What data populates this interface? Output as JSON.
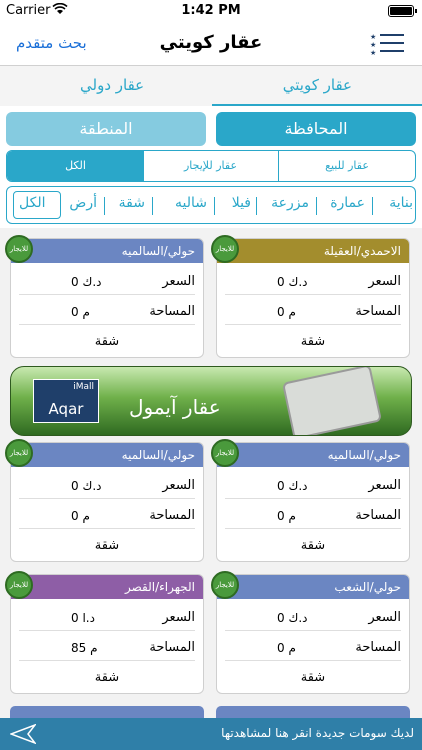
{
  "status": {
    "carrier": "Carrier",
    "time": "1:42 PM"
  },
  "nav": {
    "title": "عقار كويتي",
    "advanced": "بحث متقدم"
  },
  "tabs": {
    "kuwait": "عقار كويتي",
    "international": "عقار دولي"
  },
  "filters": {
    "governorate": "المحافظة",
    "region": "المنطقة"
  },
  "segments": {
    "sell": "عقار للبيع",
    "rent": "عقار للإيجار",
    "all": "الكل"
  },
  "types": [
    "بناية",
    "عمارة",
    "مزرعة",
    "فيلا",
    "شاليه",
    "شقة",
    "أرض",
    "الكل"
  ],
  "labels": {
    "price": "السعر",
    "area": "المساحة",
    "badge": "للايجار"
  },
  "cards": [
    {
      "location": "الاحمدي/العقيلة",
      "price": "0 د.ك",
      "area": "0 م",
      "type": "شقة",
      "color": "#a38d2d"
    },
    {
      "location": "حولي/السالميه",
      "price": "0 د.ك",
      "area": "0 م",
      "type": "شقة",
      "color": "#6b86c2"
    },
    {
      "location": "حولي/السالميه",
      "price": "0 د.ك",
      "area": "0 م",
      "type": "شقة",
      "color": "#6b86c2"
    },
    {
      "location": "حولي/السالميه",
      "price": "0 د.ك",
      "area": "0 م",
      "type": "شقة",
      "color": "#6b86c2"
    },
    {
      "location": "حولي/الشعب",
      "price": "0 د.ك",
      "area": "0 م",
      "type": "شقة",
      "color": "#6b86c2"
    },
    {
      "location": "الجهراء/القصر",
      "price": "0 د.ا",
      "area": "85 م",
      "type": "شقة",
      "color": "#8e5ea6"
    }
  ],
  "ad": {
    "logo_top": "iMall",
    "logo_bottom": "Aqar",
    "name": "عقار آيمول"
  },
  "bottom": {
    "message": "لديك سومات جديدة انقر هنا لمشاهدتها"
  },
  "colors": {
    "accent": "#2aa7c9",
    "badge": "#4a9a3c",
    "bottom_bar": "#2f7fa8"
  }
}
